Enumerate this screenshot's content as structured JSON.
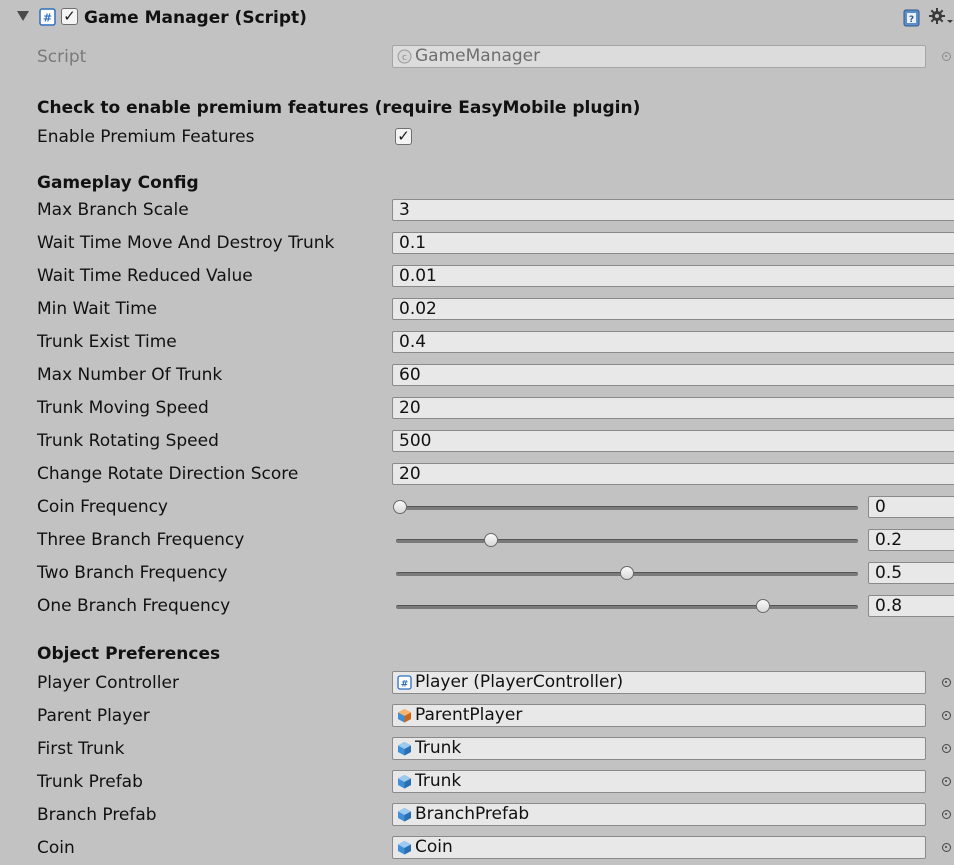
{
  "component": {
    "title": "Game Manager (Script)",
    "enabled": true,
    "script_label": "Script",
    "script_value": "GameManager"
  },
  "premium": {
    "header": "Check to enable premium features (require EasyMobile plugin)",
    "label": "Enable Premium Features",
    "checked": true
  },
  "gameplay": {
    "header": "Gameplay Config",
    "fields": [
      {
        "label": "Max Branch Scale",
        "value": "3"
      },
      {
        "label": "Wait Time Move And Destroy Trunk",
        "value": "0.1"
      },
      {
        "label": "Wait Time Reduced Value",
        "value": "0.01"
      },
      {
        "label": "Min Wait Time",
        "value": "0.02"
      },
      {
        "label": "Trunk Exist Time",
        "value": "0.4"
      },
      {
        "label": "Max Number Of Trunk",
        "value": "60"
      },
      {
        "label": "Trunk Moving Speed",
        "value": "20"
      },
      {
        "label": "Trunk Rotating Speed",
        "value": "500"
      },
      {
        "label": "Change Rotate Direction Score",
        "value": "20"
      }
    ],
    "sliders": [
      {
        "label": "Coin Frequency",
        "value": "0",
        "fraction": 0.0
      },
      {
        "label": "Three Branch Frequency",
        "value": "0.2",
        "fraction": 0.2
      },
      {
        "label": "Two Branch Frequency",
        "value": "0.5",
        "fraction": 0.5
      },
      {
        "label": "One Branch Frequency",
        "value": "0.8",
        "fraction": 0.8
      }
    ]
  },
  "objects": {
    "header": "Object Preferences",
    "fields": [
      {
        "label": "Player Controller",
        "value": "Player (PlayerController)",
        "icon": "script-icon"
      },
      {
        "label": "Parent Player",
        "value": "ParentPlayer",
        "icon": "prefab-icon"
      },
      {
        "label": "First Trunk",
        "value": "Trunk",
        "icon": "prefab-icon"
      },
      {
        "label": "Trunk Prefab",
        "value": "Trunk",
        "icon": "prefab-icon"
      },
      {
        "label": "Branch Prefab",
        "value": "BranchPrefab",
        "icon": "prefab-icon"
      },
      {
        "label": "Coin",
        "value": "Coin",
        "icon": "prefab-icon"
      }
    ]
  },
  "colors": {
    "background": "#c2c2c2",
    "field": "#e8e8e8",
    "script_icon": "#2d6fbf",
    "prefab_icon": "#3f8fd6",
    "prefab_icon_orange": "#e9812b"
  }
}
